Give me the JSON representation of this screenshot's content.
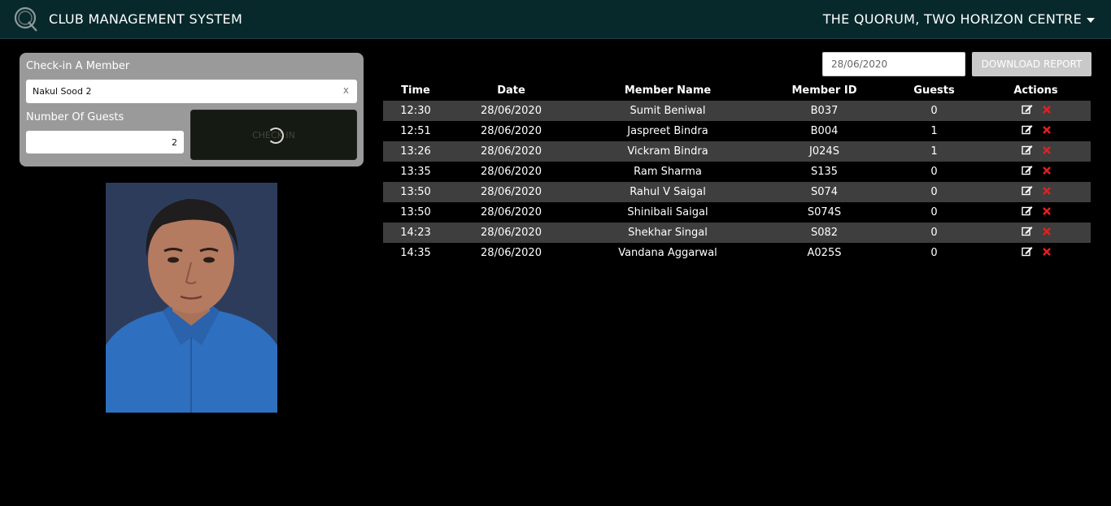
{
  "header": {
    "app_title": "CLUB MANAGEMENT SYSTEM",
    "club_name": "THE QUORUM, TWO HORIZON CENTRE"
  },
  "checkin": {
    "title": "Check-in A Member",
    "member_value": "Nakul Sood 2",
    "clear_label": "x",
    "guests_label": "Number Of Guests",
    "guests_value": "2",
    "button_label": "CHECK IN"
  },
  "report": {
    "date_value": "28/06/2020",
    "download_label": "DOWNLOAD REPORT"
  },
  "table": {
    "columns": [
      "Time",
      "Date",
      "Member Name",
      "Member ID",
      "Guests",
      "Actions"
    ],
    "rows": [
      {
        "time": "12:30",
        "date": "28/06/2020",
        "name": "Sumit Beniwal",
        "id": "B037",
        "guests": "0"
      },
      {
        "time": "12:51",
        "date": "28/06/2020",
        "name": "Jaspreet Bindra",
        "id": "B004",
        "guests": "1"
      },
      {
        "time": "13:26",
        "date": "28/06/2020",
        "name": "Vickram Bindra",
        "id": "J024S",
        "guests": "1"
      },
      {
        "time": "13:35",
        "date": "28/06/2020",
        "name": "Ram Sharma",
        "id": "S135",
        "guests": "0"
      },
      {
        "time": "13:50",
        "date": "28/06/2020",
        "name": "Rahul V Saigal",
        "id": "S074",
        "guests": "0"
      },
      {
        "time": "13:50",
        "date": "28/06/2020",
        "name": "Shinibali Saigal",
        "id": "S074S",
        "guests": "0"
      },
      {
        "time": "14:23",
        "date": "28/06/2020",
        "name": "Shekhar Singal",
        "id": "S082",
        "guests": "0"
      },
      {
        "time": "14:35",
        "date": "28/06/2020",
        "name": "Vandana Aggarwal",
        "id": "A025S",
        "guests": "0"
      }
    ]
  },
  "colors": {
    "header_bg": "#07292c",
    "panel_bg": "#9a9a9a",
    "row_stripe": "#3e3e3e",
    "delete_red": "#e02020"
  },
  "icons": {
    "logo": "quorum-logo-icon",
    "edit": "edit-icon",
    "delete": "delete-icon",
    "caret": "caret-down-icon"
  }
}
